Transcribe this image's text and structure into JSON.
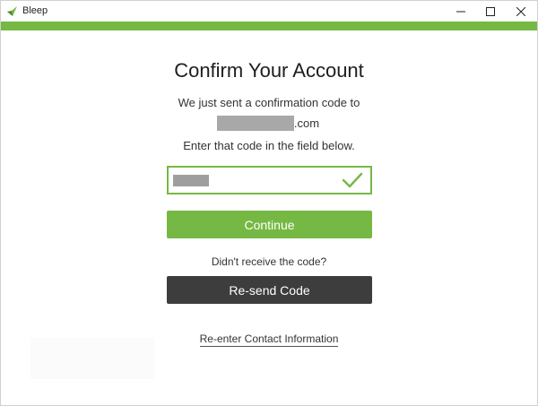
{
  "window": {
    "title": "Bleep",
    "minimize_label": "",
    "maximize_label": "",
    "close_label": ""
  },
  "colors": {
    "accent": "#76b844",
    "dark_button": "#3d3d3d"
  },
  "main": {
    "heading": "Confirm Your Account",
    "line1": "We just sent a confirmation code to",
    "email_suffix": ".com",
    "line3": "Enter that code in the field below.",
    "code_field_status_icon": "check-icon",
    "continue_label": "Continue",
    "didnt_receive": "Didn't receive the code?",
    "resend_label": "Re-send Code",
    "reenter_label": "Re-enter Contact Information"
  }
}
